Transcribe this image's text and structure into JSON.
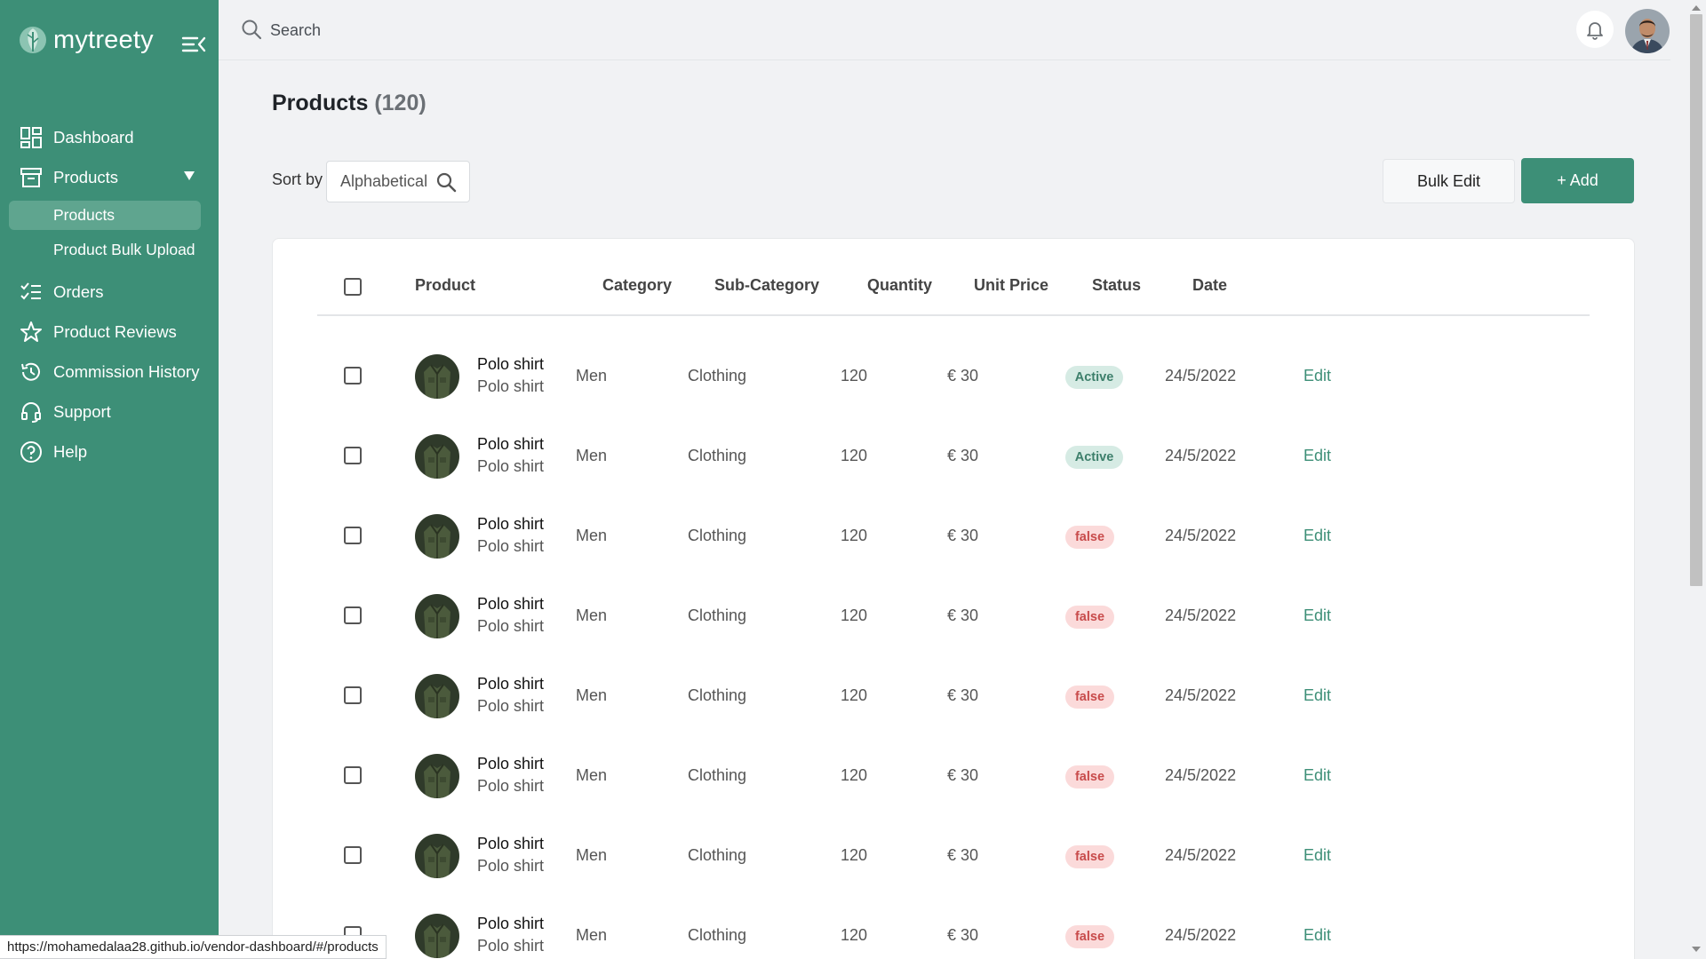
{
  "brand": {
    "name": "mytreety"
  },
  "sidebar": {
    "items": [
      {
        "label": "Dashboard",
        "icon": "dashboard-icon"
      },
      {
        "label": "Products",
        "icon": "archive-box-icon",
        "expanded": true,
        "children": [
          {
            "label": "Products",
            "active": true
          },
          {
            "label": "Product Bulk Upload",
            "active": false
          }
        ]
      },
      {
        "label": "Orders",
        "icon": "checklist-icon"
      },
      {
        "label": "Product Reviews",
        "icon": "star-icon"
      },
      {
        "label": "Commission History",
        "icon": "history-icon"
      },
      {
        "label": "Support",
        "icon": "headset-icon"
      },
      {
        "label": "Help",
        "icon": "help-icon"
      }
    ]
  },
  "topbar": {
    "search_placeholder": "Search"
  },
  "page": {
    "title": "Products",
    "count": "(120)"
  },
  "toolbar": {
    "sort_label": "Sort by",
    "sort_value": "Alphabetical",
    "bulk_edit_label": "Bulk Edit",
    "add_label": "+ Add"
  },
  "table": {
    "headers": [
      "Product",
      "Category",
      "Sub-Category",
      "Quantity",
      "Unit Price",
      "Status",
      "Date"
    ],
    "rows": [
      {
        "name": "Polo shirt",
        "sub": "Polo shirt",
        "category": "Men",
        "subcategory": "Clothing",
        "quantity": "120",
        "price": "€ 30",
        "status": "Active",
        "status_type": "active",
        "date": "24/5/2022",
        "action": "Edit"
      },
      {
        "name": "Polo shirt",
        "sub": "Polo shirt",
        "category": "Men",
        "subcategory": "Clothing",
        "quantity": "120",
        "price": "€ 30",
        "status": "Active",
        "status_type": "active",
        "date": "24/5/2022",
        "action": "Edit"
      },
      {
        "name": "Polo shirt",
        "sub": "Polo shirt",
        "category": "Men",
        "subcategory": "Clothing",
        "quantity": "120",
        "price": "€ 30",
        "status": "false",
        "status_type": "inactive",
        "date": "24/5/2022",
        "action": "Edit"
      },
      {
        "name": "Polo shirt",
        "sub": "Polo shirt",
        "category": "Men",
        "subcategory": "Clothing",
        "quantity": "120",
        "price": "€ 30",
        "status": "false",
        "status_type": "inactive",
        "date": "24/5/2022",
        "action": "Edit"
      },
      {
        "name": "Polo shirt",
        "sub": "Polo shirt",
        "category": "Men",
        "subcategory": "Clothing",
        "quantity": "120",
        "price": "€ 30",
        "status": "false",
        "status_type": "inactive",
        "date": "24/5/2022",
        "action": "Edit"
      },
      {
        "name": "Polo shirt",
        "sub": "Polo shirt",
        "category": "Men",
        "subcategory": "Clothing",
        "quantity": "120",
        "price": "€ 30",
        "status": "false",
        "status_type": "inactive",
        "date": "24/5/2022",
        "action": "Edit"
      },
      {
        "name": "Polo shirt",
        "sub": "Polo shirt",
        "category": "Men",
        "subcategory": "Clothing",
        "quantity": "120",
        "price": "€ 30",
        "status": "false",
        "status_type": "inactive",
        "date": "24/5/2022",
        "action": "Edit"
      },
      {
        "name": "Polo shirt",
        "sub": "Polo shirt",
        "category": "Men",
        "subcategory": "Clothing",
        "quantity": "120",
        "price": "€ 30",
        "status": "false",
        "status_type": "inactive",
        "date": "24/5/2022",
        "action": "Edit"
      }
    ]
  },
  "status_bar": {
    "url": "https://mohamedalaa28.github.io/vendor-dashboard/#/products"
  },
  "colors": {
    "primary": "#3d8f77",
    "sidebar_active": "#5fa58f",
    "badge_active_bg": "#d6ebe4",
    "badge_inactive_bg": "#fbdada",
    "background": "#f1f2f4"
  }
}
